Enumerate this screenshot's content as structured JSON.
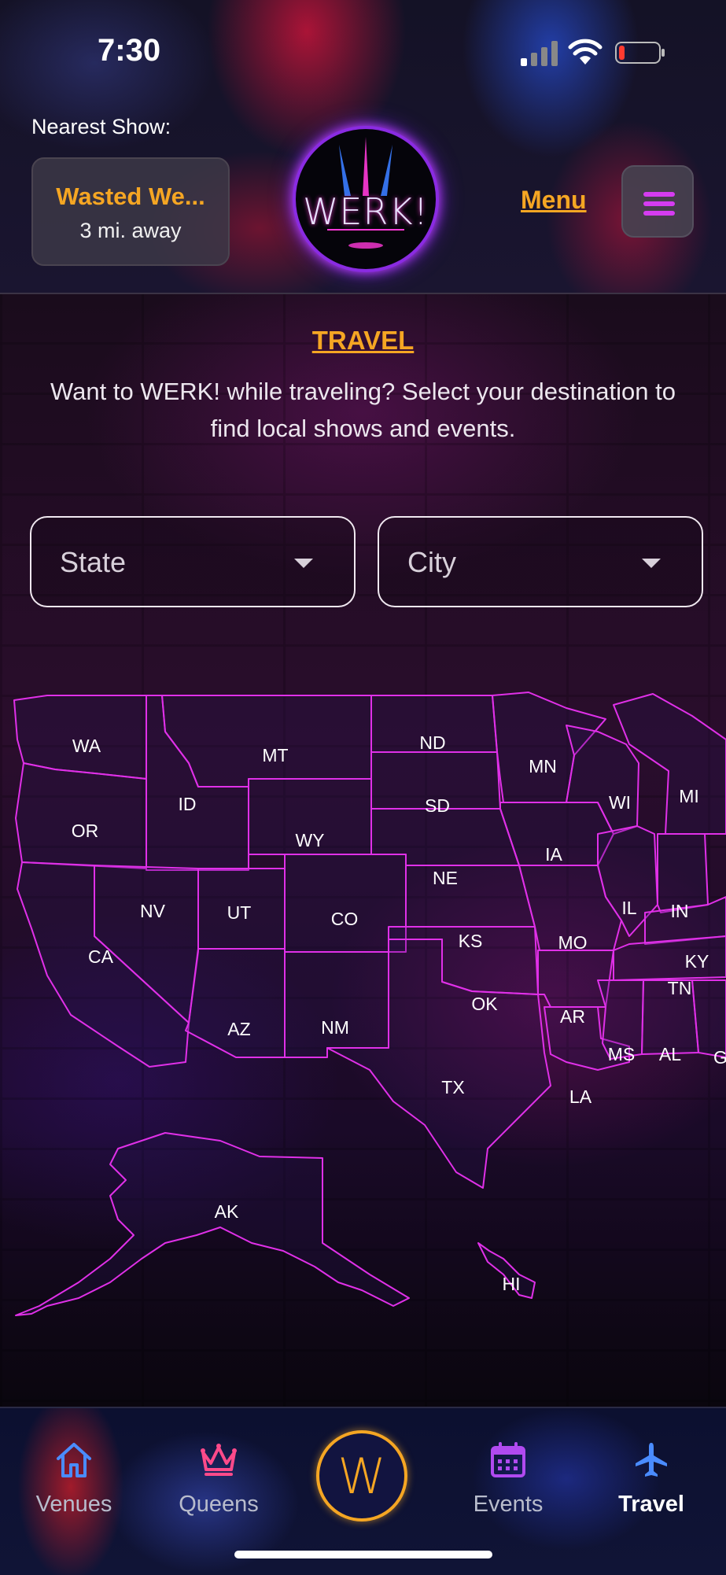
{
  "status_bar": {
    "time": "7:30"
  },
  "header": {
    "nearest_label": "Nearest Show:",
    "nearest_show": {
      "name": "Wasted We...",
      "distance": "3 mi. away"
    },
    "logo_text": "WERK!",
    "menu_label": "Menu"
  },
  "travel": {
    "title": "TRAVEL",
    "description": "Want to WERK! while traveling? Select your destination to find local shows and events.",
    "state_placeholder": "State",
    "city_placeholder": "City"
  },
  "map": {
    "states": [
      "WA",
      "MT",
      "ND",
      "MN",
      "MI",
      "OR",
      "ID",
      "SD",
      "WI",
      "WY",
      "IA",
      "NE",
      "IL",
      "IN",
      "NV",
      "UT",
      "CO",
      "CA",
      "KS",
      "MO",
      "KY",
      "TN",
      "OK",
      "AR",
      "AZ",
      "NM",
      "MS",
      "AL",
      "G",
      "TX",
      "LA",
      "AK",
      "HI"
    ]
  },
  "tabs": [
    {
      "label": "Venues",
      "icon": "home-icon"
    },
    {
      "label": "Queens",
      "icon": "crown-icon"
    },
    {
      "label": "W",
      "icon": "werk-logo-icon"
    },
    {
      "label": "Events",
      "icon": "calendar-icon"
    },
    {
      "label": "Travel",
      "icon": "airplane-icon"
    }
  ],
  "colors": {
    "accent": "#f5a623",
    "neon": "#e030e8",
    "menu_lines": "#d53cf0"
  }
}
